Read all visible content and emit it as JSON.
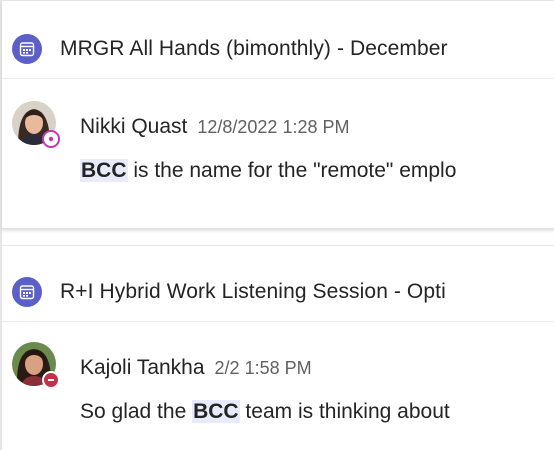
{
  "results": [
    {
      "meeting_title": "MRGR All Hands (bimonthly) - December",
      "meeting_icon": "calendar-icon",
      "author": "Nikki Quast",
      "timestamp": "12/8/2022 1:28 PM",
      "presence": "out-of-office",
      "text_before": "",
      "highlight": "BCC",
      "text_after": " is the name for the \"remote\" emplo"
    },
    {
      "meeting_title": "R+I Hybrid Work Listening Session - Opti",
      "meeting_icon": "calendar-icon",
      "author": "Kajoli Tankha",
      "timestamp": "2/2 1:58 PM",
      "presence": "do-not-disturb",
      "text_before": "So glad the ",
      "highlight": "BCC",
      "text_after": " team is thinking about"
    }
  ],
  "colors": {
    "accent": "#5b5fc7",
    "highlight_bg": "#e8ebfa",
    "presence_ooo": "#c239b3",
    "presence_dnd": "#c4314b"
  }
}
